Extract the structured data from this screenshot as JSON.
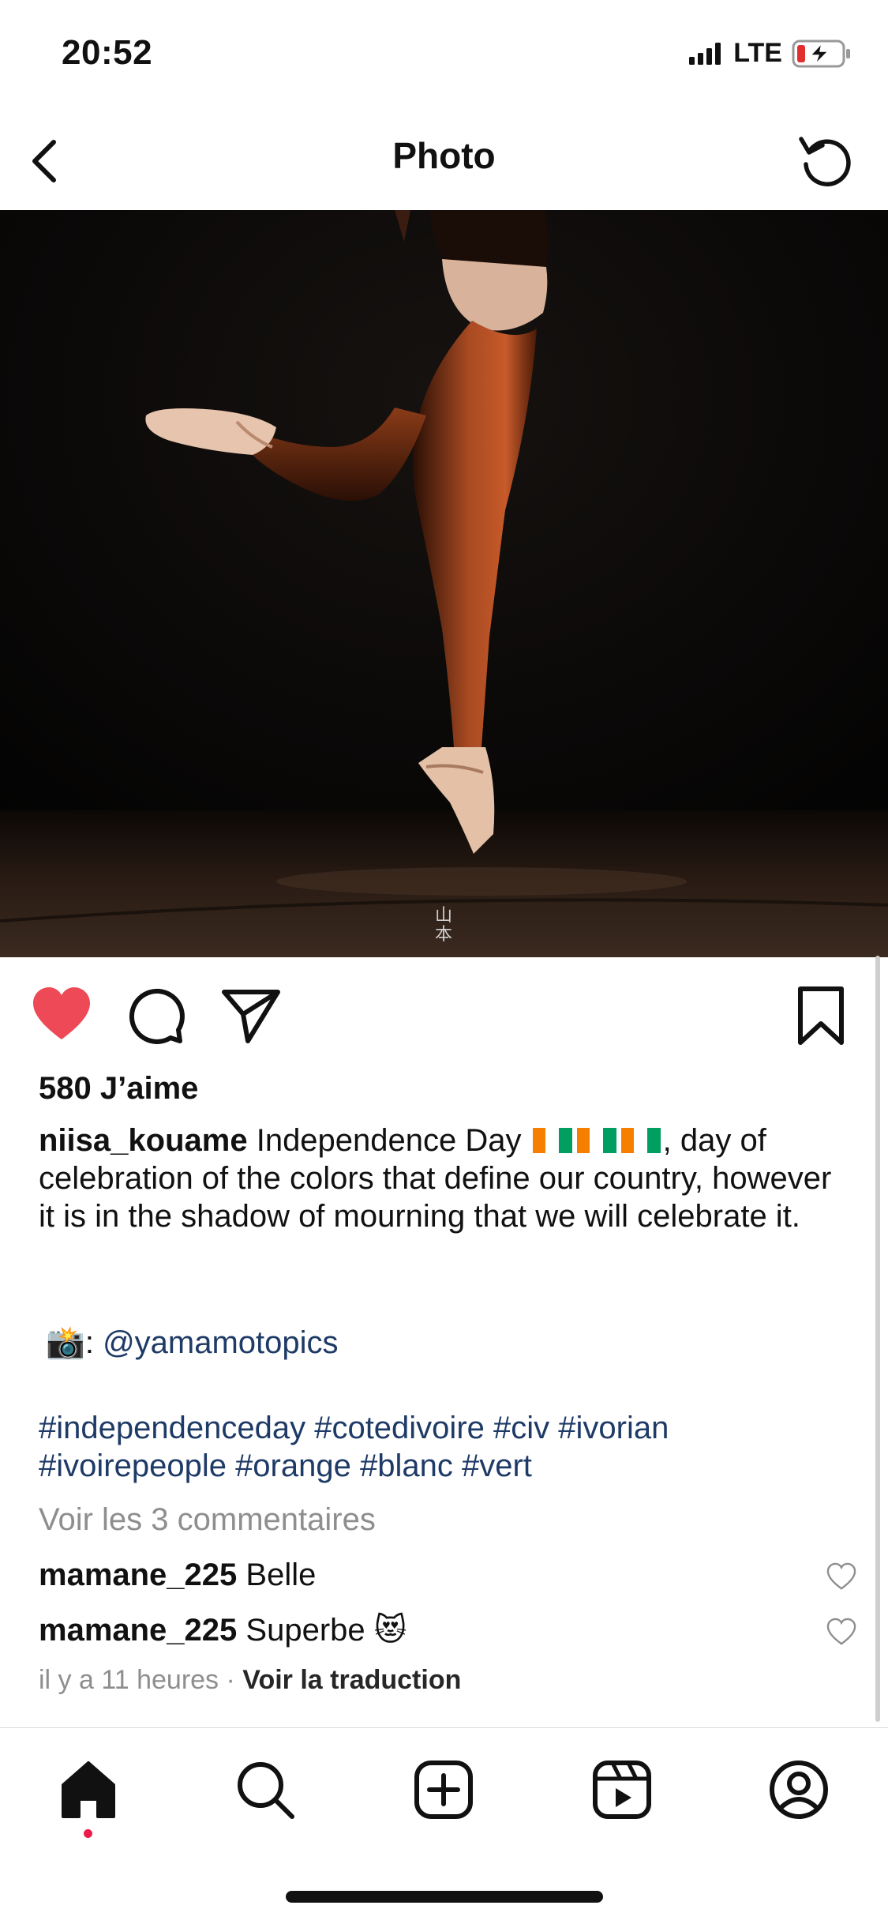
{
  "status_bar": {
    "time": "20:52",
    "network": "LTE"
  },
  "nav": {
    "title": "Photo"
  },
  "post": {
    "likes_text": "580 J’aime",
    "caption": {
      "username": "niisa_kouame",
      "text_before_flags": "Independence Day",
      "text_after_flags": ", day of celebration of the colors that define our country, however it is in the shadow of mourning that we will celebrate it."
    },
    "flag_colors": [
      "#f77f00",
      "#ffffff",
      "#009e60"
    ],
    "credit": {
      "emoji": "📸",
      "separator": ":",
      "mention": "@yamamotopics"
    },
    "hashtags_line1": "#independenceday #cotedivoire #civ #ivorian",
    "hashtags_line2": "#ivoirepeople #orange #blanc #vert",
    "view_comments": "Voir les 3 commentaires",
    "comments": [
      {
        "username": "mamane_225",
        "text": "Belle"
      },
      {
        "username": "mamane_225",
        "text": "Superbe",
        "emoji": "😻"
      }
    ],
    "time_ago": "il y a 11 heures",
    "dot": "·",
    "translate_label": "Voir la traduction"
  },
  "colors": {
    "like_red": "#ed4956",
    "link_blue": "#1e3a66",
    "muted_gray": "#8e8e8e"
  },
  "tab_bar": {
    "items": [
      "home-icon",
      "search-icon",
      "add-post-icon",
      "reels-icon",
      "profile-icon"
    ]
  }
}
